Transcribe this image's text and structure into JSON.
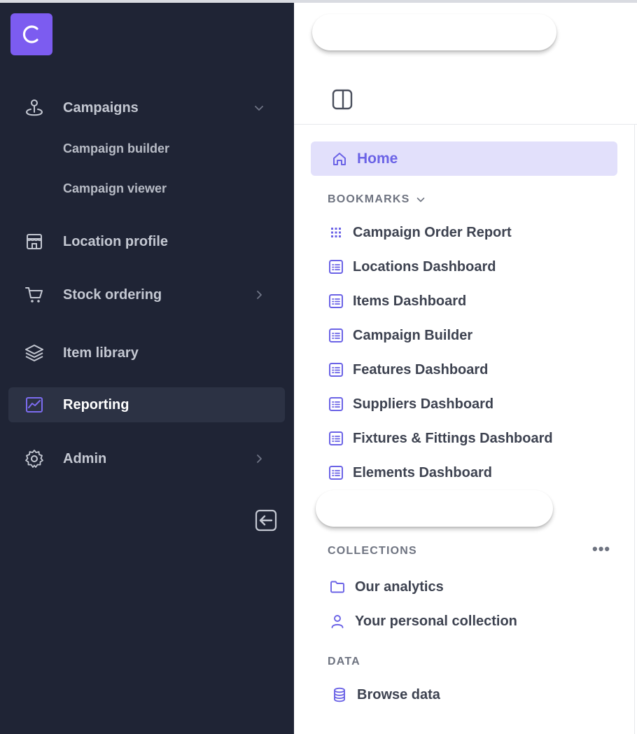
{
  "brand": {
    "logo_letter": "C",
    "logo_color": "#7c5cf0"
  },
  "sidebar": {
    "items": [
      {
        "label": "Campaigns",
        "icon": "map-pin-icon",
        "expandable": "down"
      },
      {
        "label": "Location profile",
        "icon": "store-icon"
      },
      {
        "label": "Stock ordering",
        "icon": "cart-icon",
        "expandable": "right"
      },
      {
        "label": "Item library",
        "icon": "layers-icon"
      },
      {
        "label": "Reporting",
        "icon": "chart-icon",
        "active": true
      },
      {
        "label": "Admin",
        "icon": "gear-icon",
        "expandable": "right"
      }
    ],
    "campaign_subitems": [
      "Campaign builder",
      "Campaign viewer"
    ],
    "collapse_icon": "collapse-left-icon"
  },
  "panel": {
    "home_label": "Home",
    "bookmarks_header": "BOOKMARKS",
    "bookmarks": [
      {
        "label": "Campaign Order Report",
        "icon": "grid-icon"
      },
      {
        "label": "Locations Dashboard",
        "icon": "dashboard-icon"
      },
      {
        "label": "Items Dashboard",
        "icon": "dashboard-icon"
      },
      {
        "label": "Campaign Builder",
        "icon": "dashboard-icon"
      },
      {
        "label": "Features Dashboard",
        "icon": "dashboard-icon"
      },
      {
        "label": "Suppliers Dashboard",
        "icon": "dashboard-icon"
      },
      {
        "label": "Fixtures & Fittings Dashboard",
        "icon": "dashboard-icon"
      },
      {
        "label": "Elements Dashboard",
        "icon": "dashboard-icon"
      }
    ],
    "collections_header": "COLLECTIONS",
    "collections_more": "•••",
    "collections": [
      {
        "label": "Our analytics",
        "icon": "folder-icon"
      },
      {
        "label": "Your personal collection",
        "icon": "person-icon"
      }
    ],
    "data_header": "DATA",
    "data_items": [
      {
        "label": "Browse data",
        "icon": "database-icon"
      }
    ]
  },
  "colors": {
    "sidebar_bg": "#1f2435",
    "accent": "#6b63e6",
    "home_bg": "#e2e0fb"
  }
}
